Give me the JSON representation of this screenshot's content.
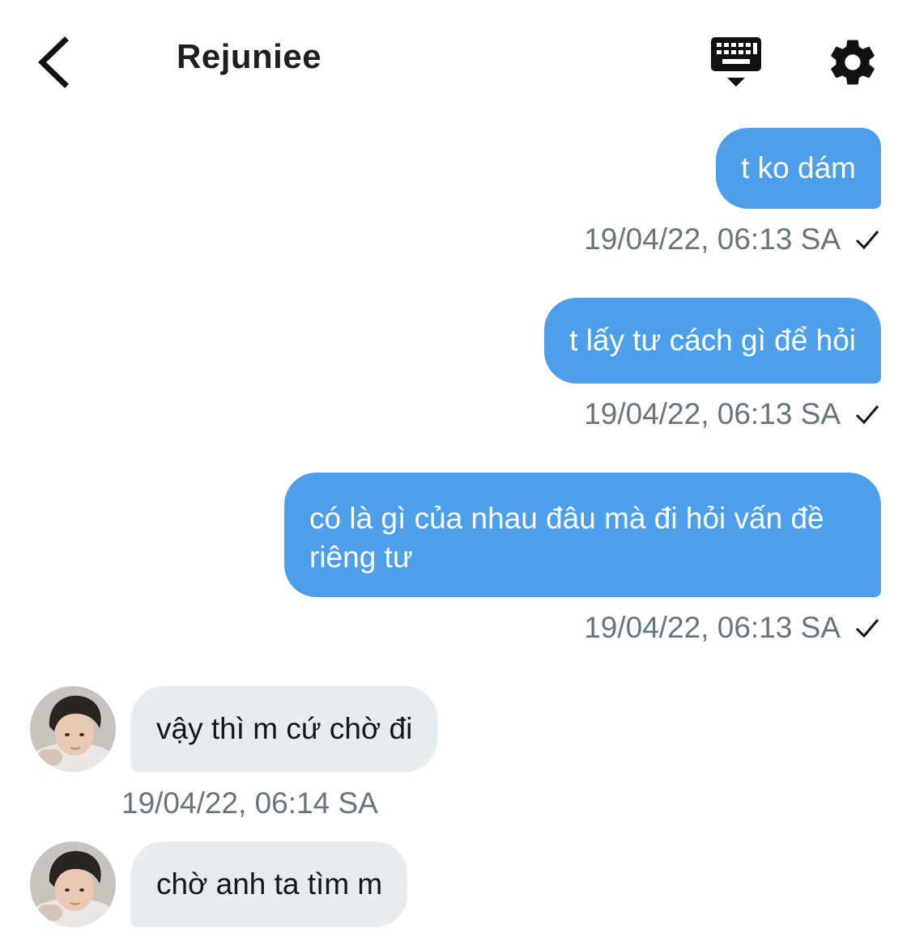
{
  "header": {
    "title": "Rejuniee",
    "back_icon": "chevron-left-icon",
    "keyboard_icon": "keyboard-hide-icon",
    "settings_icon": "gear-icon"
  },
  "colors": {
    "sent_bubble": "#4c9fe8",
    "received_bubble": "#e6ecf0",
    "timestamp": "#66757f"
  },
  "messages": {
    "sent": [
      {
        "text": "t ko dám",
        "time": "19/04/22, 06:13 SA",
        "status_icon": "check-icon"
      },
      {
        "text": "t lấy tư cách gì để hỏi",
        "time": "19/04/22, 06:13 SA",
        "status_icon": "check-icon"
      },
      {
        "text": "có là gì của nhau đâu mà đi hỏi vấn đề riêng tư",
        "time": "19/04/22, 06:13 SA",
        "status_icon": "check-icon"
      }
    ],
    "received": [
      {
        "text": "vậy thì m cứ chờ đi",
        "time": "19/04/22, 06:14 SA"
      },
      {
        "text": "chờ anh ta tìm m"
      }
    ]
  }
}
